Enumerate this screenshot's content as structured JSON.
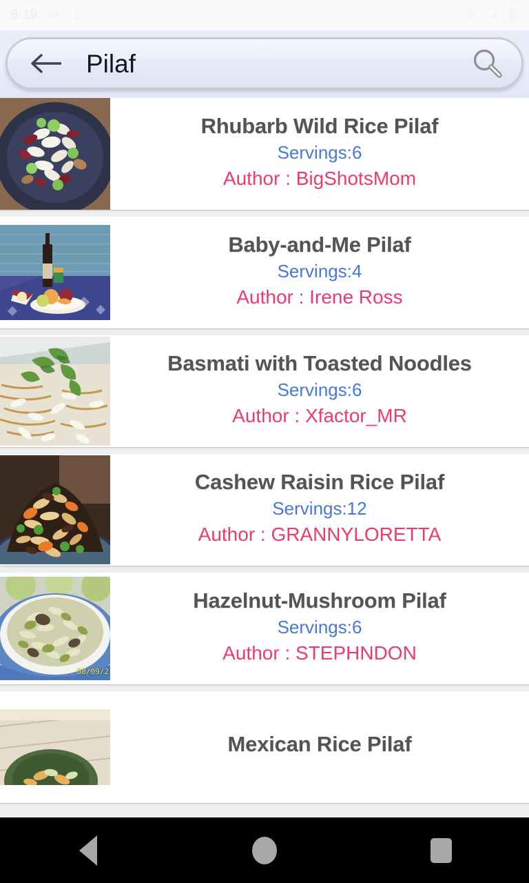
{
  "statusbar": {
    "time": "6:19",
    "left_icons": [
      "message-icon",
      "battery-saver-icon",
      "alarm-icon"
    ],
    "right_icons": [
      "wifi-icon",
      "signal-icon",
      "battery-icon"
    ]
  },
  "searchbar": {
    "back_icon": "back-arrow-icon",
    "query": "Pilaf",
    "placeholder": "Search",
    "search_icon": "search-icon"
  },
  "colors": {
    "title": "#545454",
    "servings": "#4678db",
    "author": "#ef3a6c",
    "card_bg": "#ffffff",
    "list_bg": "#efefef",
    "navbar_bg": "#000000"
  },
  "recipes": [
    {
      "title": "Rhubarb Wild Rice Pilaf",
      "servings": "Servings:6",
      "author": "Author : BigShotsMom",
      "image_alt": "rhubarb-wild-rice-pilaf-on-blue-plate",
      "stamp": ""
    },
    {
      "title": "Baby-and-Me Pilaf",
      "servings": "Servings:4",
      "author": "Author : Irene Ross",
      "image_alt": "wine-bottle-and-fruit-by-the-sea",
      "stamp": ""
    },
    {
      "title": "Basmati with Toasted Noodles",
      "servings": "Servings:6",
      "author": "Author : Xfactor_MR",
      "image_alt": "basmati-rice-with-herbs-and-noodles",
      "stamp": ""
    },
    {
      "title": "Cashew Raisin Rice Pilaf",
      "servings": "Servings:12",
      "author": "Author : GRANNYLORETTA",
      "image_alt": "cashew-raisin-rice-pilaf-with-carrots-and-peas",
      "stamp": ""
    },
    {
      "title": "Hazelnut-Mushroom Pilaf",
      "servings": "Servings:6",
      "author": "Author : STEPHNDON",
      "image_alt": "hazelnut-mushroom-pilaf-in-blue-bowl",
      "stamp": "08/09/2"
    },
    {
      "title": "Mexican Rice Pilaf",
      "servings": "",
      "author": "",
      "image_alt": "mexican-rice-pilaf-in-green-bowl-on-wood",
      "stamp": ""
    }
  ],
  "navbar": {
    "back_label": "Back",
    "home_label": "Home",
    "recents_label": "Recents"
  }
}
